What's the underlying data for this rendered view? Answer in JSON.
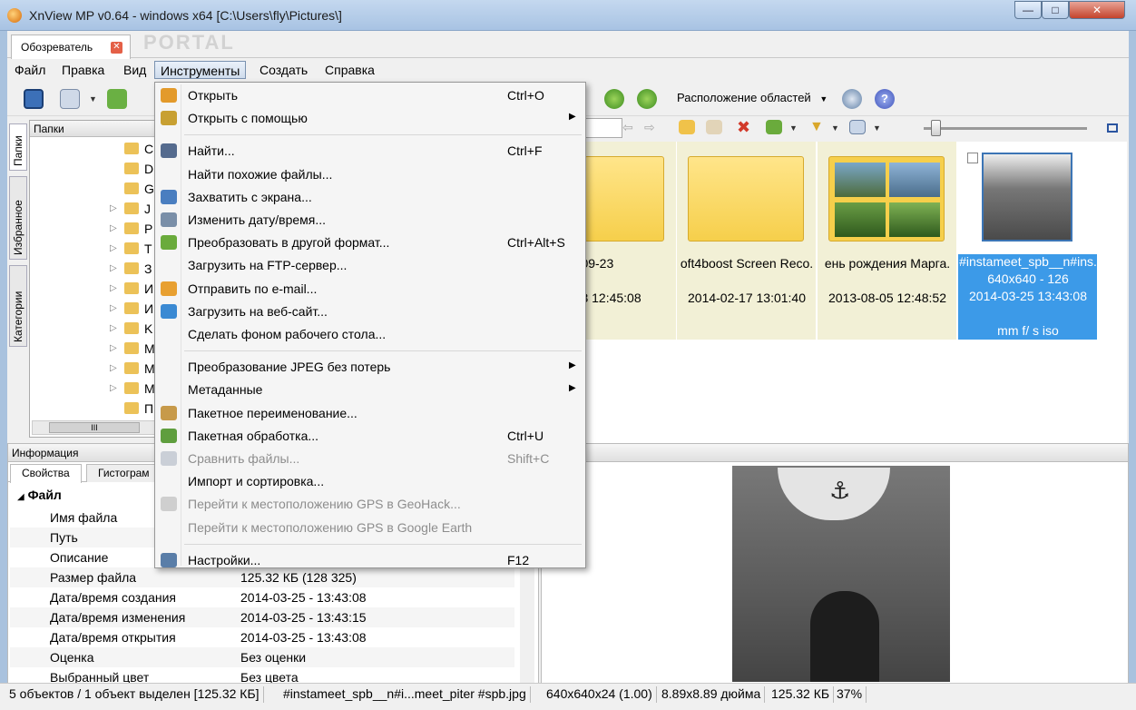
{
  "window": {
    "title": "XnView MP v0.64 - windows x64 [C:\\Users\\fly\\Pictures\\]",
    "min": "—",
    "max": "□",
    "close": "✕"
  },
  "doc_tab": {
    "label": "Обозреватель",
    "close": "✕"
  },
  "watermark": "PORTAL",
  "menubar": [
    "Файл",
    "Правка",
    "Вид",
    "Инструменты",
    "Создать",
    "Справка"
  ],
  "toolbar": {
    "layout_label": "Расположение областей"
  },
  "side_tabs": {
    "folders": "Папки",
    "favorites": "Избранное",
    "categories": "Категории"
  },
  "folders_panel": {
    "header": "Папки",
    "rows": [
      "C",
      "D",
      "G",
      "J",
      "P",
      "T",
      "З",
      "И",
      "И",
      "K",
      "M",
      "M",
      "M",
      "П"
    ],
    "scroll_thumb": "III"
  },
  "thumbnails": [
    {
      "line1": "3-09-23",
      "line2": "-23 12:45:08",
      "kind": "folder"
    },
    {
      "line1": "oft4boost Screen Reco.",
      "line2": "2014-02-17 13:01:40",
      "kind": "folder"
    },
    {
      "line1": "ень рождения Марга.",
      "line2": "2013-08-05 12:48:52",
      "kind": "album"
    },
    {
      "line1": "#instameet_spb__n#ins.",
      "line2": "640x640 - 126",
      "line3": "2014-03-25 13:43:08",
      "line4": "",
      "line5": "mm f/ s iso",
      "kind": "photo"
    }
  ],
  "info_panel": {
    "header": "Информация",
    "tabs": [
      "Свойства",
      "Гистограм"
    ],
    "group": "Файл",
    "rows": [
      {
        "label": "Имя файла",
        "value": ""
      },
      {
        "label": "Путь",
        "value": ""
      },
      {
        "label": "Описание",
        "value": ""
      },
      {
        "label": "Размер файла",
        "value": "125.32 КБ (128 325)"
      },
      {
        "label": "Дата/время создания",
        "value": "2014-03-25 - 13:43:08"
      },
      {
        "label": "Дата/время изменения",
        "value": "2014-03-25 - 13:43:15"
      },
      {
        "label": "Дата/время открытия",
        "value": "2014-03-25 - 13:43:08"
      },
      {
        "label": "Оценка",
        "value": "Без оценки"
      },
      {
        "label": "Выбранный цвет",
        "value": "Без цвета"
      }
    ]
  },
  "preview_panel": {
    "header": "смотр"
  },
  "tools_menu": [
    {
      "label": "Открыть",
      "key": "Ctrl+O",
      "icon_color": "#e39a2b"
    },
    {
      "label": "Открыть с помощью",
      "key": "",
      "submenu": true,
      "icon_color": "#c8a032"
    },
    {
      "sep": true
    },
    {
      "label": "Найти...",
      "key": "Ctrl+F",
      "icon_color": "#556b8e"
    },
    {
      "label": "Найти похожие файлы...",
      "key": ""
    },
    {
      "label": "Захватить с экрана...",
      "key": "",
      "icon_color": "#4a7ec0"
    },
    {
      "label": "Изменить дату/время...",
      "key": "",
      "icon_color": "#7a8fa8"
    },
    {
      "label": "Преобразовать в другой формат...",
      "key": "Ctrl+Alt+S",
      "icon_color": "#6aab3c"
    },
    {
      "label": "Загрузить на FTP-сервер...",
      "key": ""
    },
    {
      "label": "Отправить по e-mail...",
      "key": "",
      "icon_color": "#e8a031"
    },
    {
      "label": "Загрузить на веб-сайт...",
      "key": "",
      "icon_color": "#3b8ad3"
    },
    {
      "label": "Сделать фоном рабочего стола...",
      "key": ""
    },
    {
      "sep": true
    },
    {
      "label": "Преобразование JPEG без потерь",
      "key": "",
      "submenu": true
    },
    {
      "label": "Метаданные",
      "key": "",
      "submenu": true
    },
    {
      "label": "Пакетное переименование...",
      "key": "",
      "icon_color": "#c79a4a"
    },
    {
      "label": "Пакетная обработка...",
      "key": "Ctrl+U",
      "icon_color": "#5f9e3e"
    },
    {
      "label": "Сравнить файлы...",
      "key": "Shift+C",
      "disabled": true,
      "icon_color": "#7a8aa0"
    },
    {
      "label": "Импорт и сортировка...",
      "key": ""
    },
    {
      "label": "Перейти к местоположению GPS в GeoHack...",
      "key": "",
      "disabled": true,
      "icon_color": "#8a8a8a"
    },
    {
      "label": "Перейти к местоположению GPS в Google Earth",
      "key": "",
      "disabled": true
    },
    {
      "sep": true
    },
    {
      "label": "Настройки...",
      "key": "F12",
      "icon_color": "#5a7ea8"
    }
  ],
  "statusbar": [
    "5 объектов / 1 объект выделен [125.32 КБ]",
    "#instameet_spb__n#i...meet_piter #spb.jpg",
    "640x640x24 (1.00)",
    "8.89x8.89 дюйма",
    "125.32 КБ",
    "37%"
  ]
}
